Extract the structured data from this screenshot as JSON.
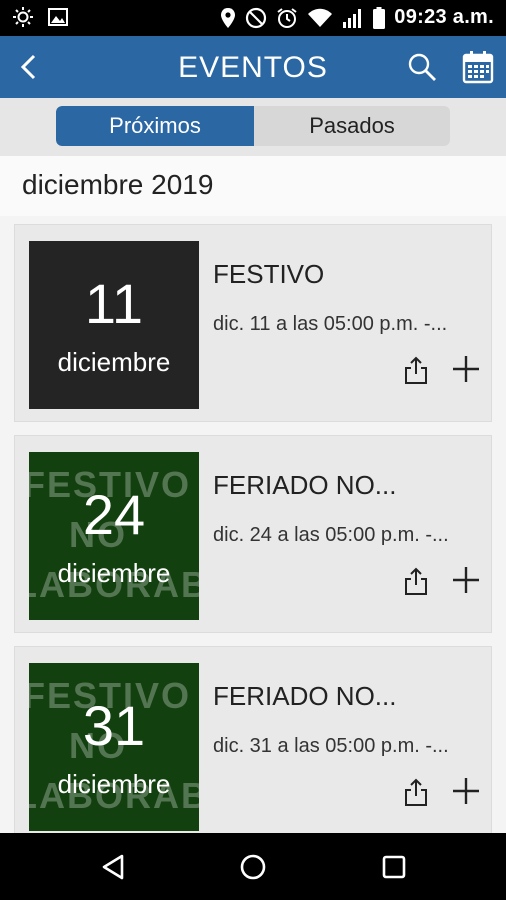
{
  "status_bar": {
    "time": "09:23 a.m.",
    "left_icons": [
      "brightness-icon",
      "image-icon"
    ],
    "right_icons": [
      "location-icon",
      "do-not-disturb-icon",
      "alarm-icon",
      "wifi-icon",
      "signal-icon",
      "battery-icon"
    ]
  },
  "app_bar": {
    "title": "EVENTOS",
    "left_icon": "back-chevron-icon",
    "right_icons": [
      "search-icon",
      "calendar-icon"
    ],
    "color": "#2a67a3"
  },
  "tabs": [
    {
      "label": "Próximos",
      "active": true
    },
    {
      "label": "Pasados",
      "active": false
    }
  ],
  "section": {
    "month": "diciembre 2019"
  },
  "events": [
    {
      "day": "11",
      "month": "diciembre",
      "title": "FESTIVO",
      "time": "dic. 11 a las 05:00 p.m. -...",
      "style": "dark",
      "watermark": []
    },
    {
      "day": "24",
      "month": "diciembre",
      "title": "FERIADO NO...",
      "time": "dic. 24 a las 05:00 p.m. -...",
      "style": "green",
      "watermark": [
        "FESTIVO",
        "NO",
        "LABORABLE"
      ]
    },
    {
      "day": "31",
      "month": "diciembre",
      "title": "FERIADO NO...",
      "time": "dic. 31 a las 05:00 p.m. -...",
      "style": "green",
      "watermark": [
        "FESTIVO",
        "NO",
        "LABORABLE"
      ]
    }
  ],
  "event_actions": [
    "share-icon",
    "add-icon"
  ],
  "nav_bar": [
    "back-triangle-icon",
    "home-circle-icon",
    "recents-square-icon"
  ]
}
